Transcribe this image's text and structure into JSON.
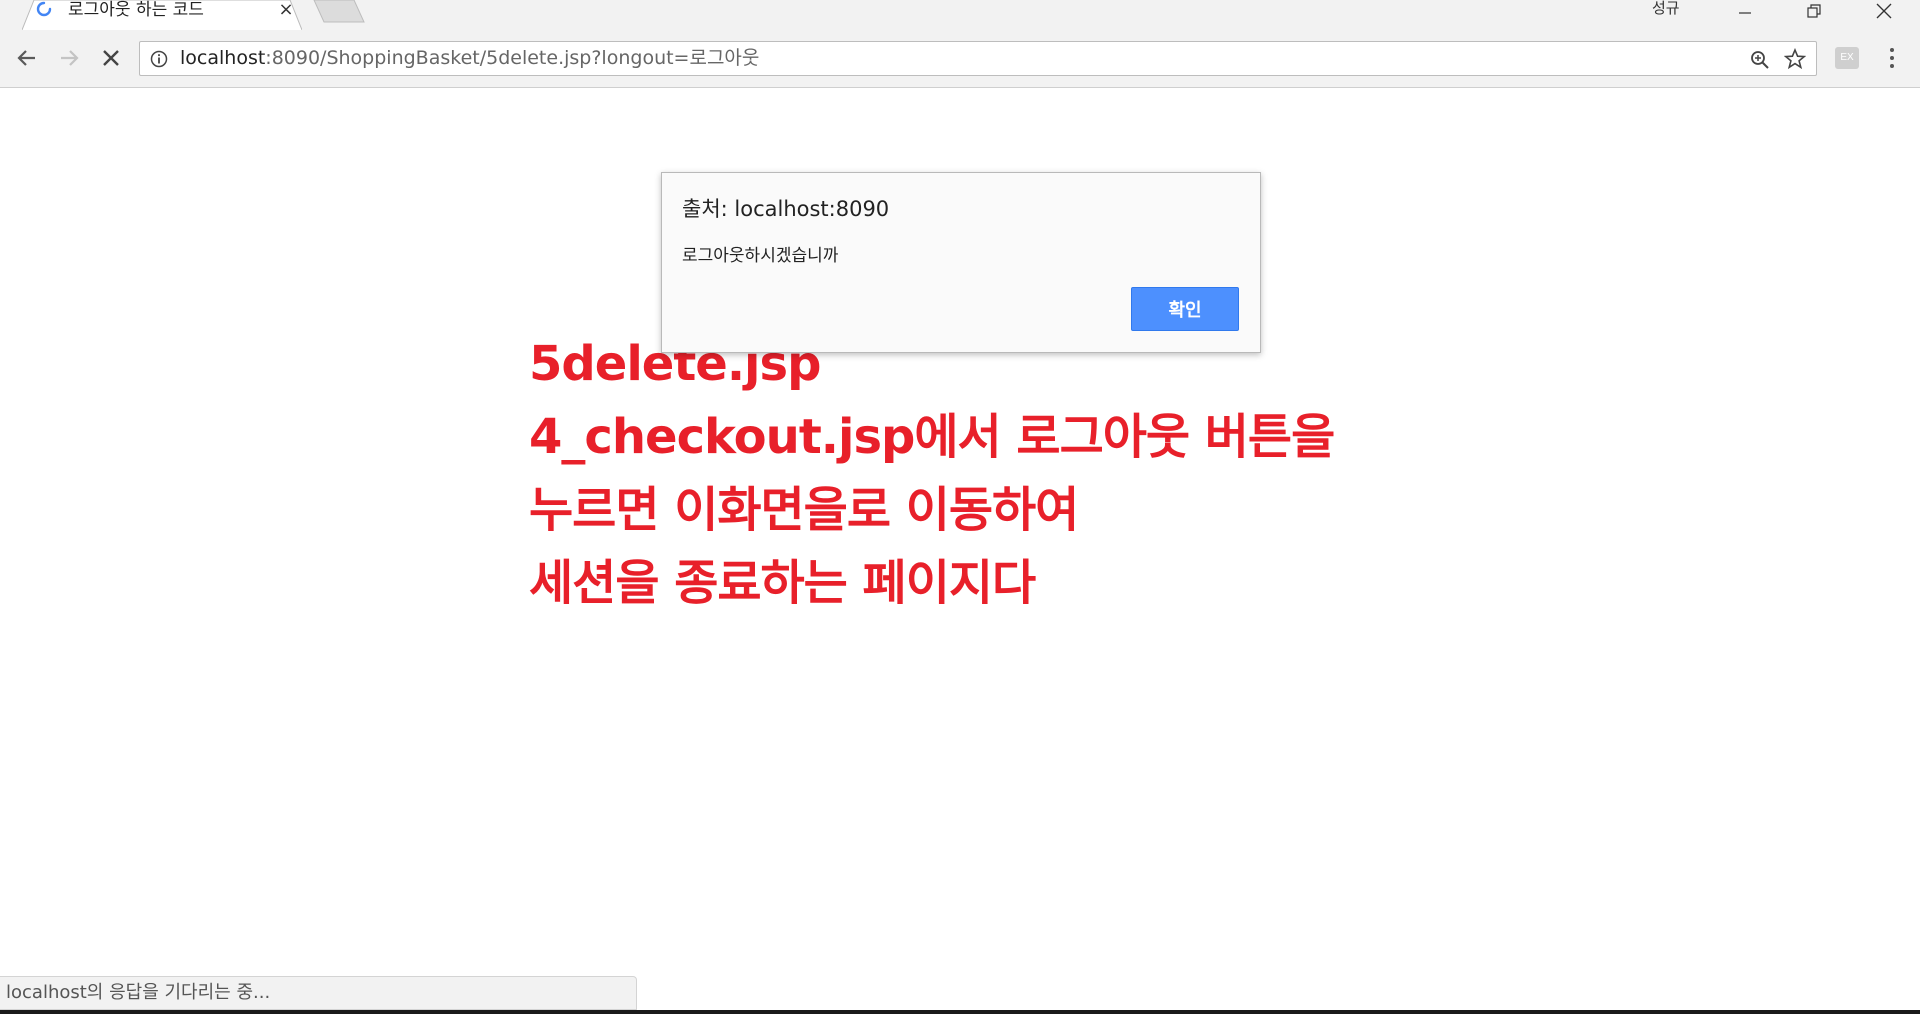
{
  "tab": {
    "title": "로그아웃 하는 코드",
    "close_label": "×"
  },
  "window": {
    "profile_name": "성규"
  },
  "toolbar": {
    "url_host": "localhost",
    "url_rest": ":8090/ShoppingBasket/5delete.jsp?longout=로그아웃",
    "extension_label": "EX"
  },
  "content": {
    "lines": [
      "5delete.jsp",
      "4_checkout.jsp에서 로그아웃 버튼을",
      "누르면 이화면을로 이동하여",
      "세션을 종료하는 페이지다"
    ]
  },
  "dialog": {
    "origin": "출처: localhost:8090",
    "message": "로그아웃하시겠습니까",
    "ok_label": "확인"
  },
  "status": {
    "text": "localhost의 응답을 기다리는 중..."
  },
  "colors": {
    "accent_text": "#e8202a",
    "button_blue": "#4d90fe",
    "chrome_bg": "#f2f2f2"
  }
}
